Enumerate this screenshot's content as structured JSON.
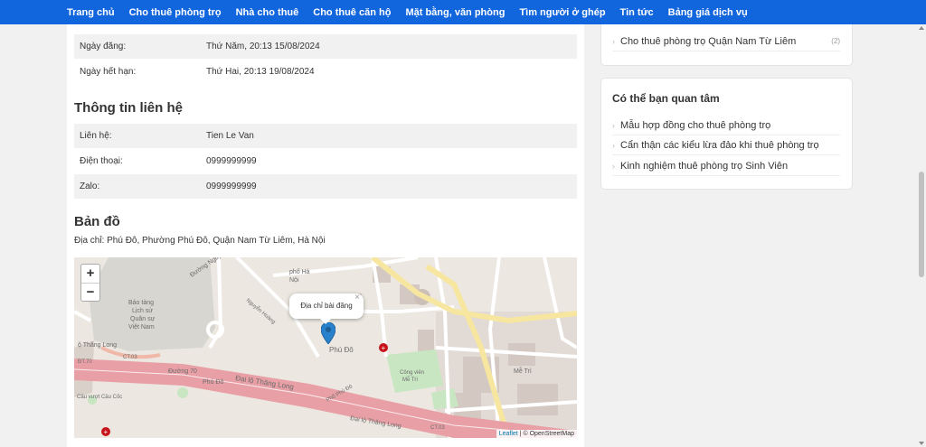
{
  "nav": {
    "items": [
      "Trang chủ",
      "Cho thuê phòng trọ",
      "Nhà cho thuê",
      "Cho thuê căn hộ",
      "Mặt bằng, văn phòng",
      "Tìm người ở ghép",
      "Tin tức",
      "Bảng giá dịch vụ"
    ]
  },
  "post_info": {
    "rows": [
      {
        "label": "Ngày đăng:",
        "value": "Thứ Năm, 20:13 15/08/2024"
      },
      {
        "label": "Ngày hết hạn:",
        "value": "Thứ Hai, 20:13 19/08/2024"
      }
    ]
  },
  "contact": {
    "heading": "Thông tin liên hệ",
    "rows": [
      {
        "label": "Liên hệ:",
        "value": "Tien Le Van"
      },
      {
        "label": "Điện thoại:",
        "value": "0999999999"
      },
      {
        "label": "Zalo:",
        "value": "0999999999"
      }
    ]
  },
  "map_section": {
    "heading": "Bản đồ",
    "address": "Địa chỉ: Phú Đô, Phường Phú Đô, Quận Nam Từ Liêm, Hà Nội",
    "popup_text": "Địa chỉ bài đăng",
    "zoom_in": "+",
    "zoom_out": "−",
    "popup_close": "×",
    "attribution_link": "Leaflet",
    "attribution_text": " | © OpenStreetMap",
    "labels": {
      "road1": "Đường Nguyễn Văn Giáp",
      "museum": [
        "Bảo tàng",
        "Lịch sử",
        "Quân sự",
        "Việt Nam"
      ],
      "thanglong": "Đại lộ Thăng Long",
      "thanglong2": "Đại lộ Thăng Long",
      "ct03": "CT.03",
      "ct03b": "CT.03",
      "d70": "Đường 70",
      "phudo": "Phú Đô",
      "phudo2": "Phú Đô",
      "park": [
        "Công viên",
        "Mễ Trì"
      ],
      "mtri": "Mễ Trì",
      "phuhanoi": [
        "phố Hà",
        "Nội"
      ],
      "dt70": "ĐT.70",
      "caovuot": "Cầu vượt Cầu Cốc",
      "thanglong_left": "ộ Thăng Long",
      "nguyenhoang": "Nguyễn Hoàng",
      "phodo3": "Phố Phú Đô"
    }
  },
  "sidebar": {
    "box1": {
      "items": [
        {
          "label": "Cho thuê phòng trọ Quận Nam Từ Liêm",
          "count": "(2)"
        }
      ]
    },
    "box2": {
      "title": "Có thể bạn quan tâm",
      "items": [
        {
          "label": "Mẫu hợp đồng cho thuê phòng trọ"
        },
        {
          "label": "Cẩn thận các kiểu lừa đảo khi thuê phòng trọ"
        },
        {
          "label": "Kinh nghiệm thuê phòng trọ Sinh Viên"
        }
      ]
    }
  },
  "colors": {
    "nav_bg": "#1266dd",
    "marker": "#2a81cb",
    "major_road": "#e8a0a6",
    "park": "#c8e6c2"
  }
}
